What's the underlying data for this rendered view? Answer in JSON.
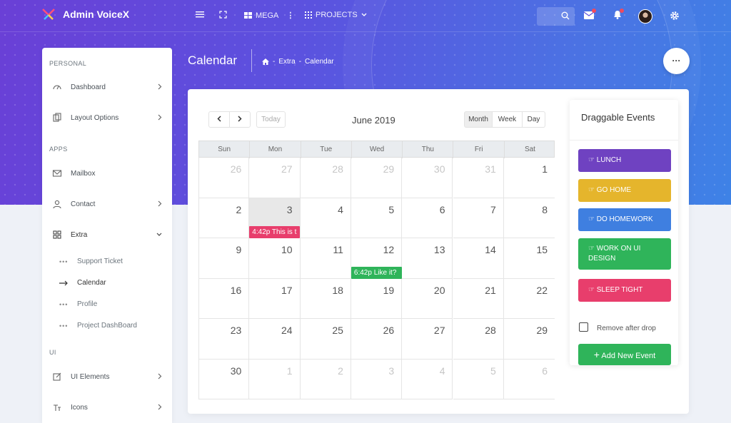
{
  "app": {
    "title": "Admin VoiceX"
  },
  "topbar": {
    "mega_label": "MEGA",
    "projects_label": "PROJECTS"
  },
  "sidebar": {
    "section_personal": "PERSONAL",
    "section_apps": "APPS",
    "section_ui": "UI",
    "items": [
      {
        "label": "Dashboard"
      },
      {
        "label": "Layout Options"
      },
      {
        "label": "Mailbox"
      },
      {
        "label": "Contact"
      },
      {
        "label": "Extra"
      },
      {
        "label": "UI Elements"
      },
      {
        "label": "Icons"
      }
    ],
    "extra_sub": [
      {
        "label": "Support Ticket"
      },
      {
        "label": "Calendar"
      },
      {
        "label": "Profile"
      },
      {
        "label": "Project DashBoard"
      }
    ]
  },
  "page": {
    "title": "Calendar",
    "breadcrumb": [
      "Extra",
      "Calendar"
    ],
    "more_label": "···"
  },
  "calendar": {
    "month_title": "June 2019",
    "today_label": "Today",
    "views": [
      "Month",
      "Week",
      "Day"
    ],
    "weekdays": [
      "Sun",
      "Mon",
      "Tue",
      "Wed",
      "Thu",
      "Fri",
      "Sat"
    ],
    "weeks": [
      [
        "26",
        "27",
        "28",
        "29",
        "30",
        "31",
        "1"
      ],
      [
        "2",
        "3",
        "4",
        "5",
        "6",
        "7",
        "8"
      ],
      [
        "9",
        "10",
        "11",
        "12",
        "13",
        "14",
        "15"
      ],
      [
        "16",
        "17",
        "18",
        "19",
        "20",
        "21",
        "22"
      ],
      [
        "23",
        "24",
        "25",
        "26",
        "27",
        "28",
        "29"
      ],
      [
        "30",
        "1",
        "2",
        "3",
        "4",
        "5",
        "6"
      ]
    ],
    "events": [
      {
        "text": "4:42p This is t",
        "color": "#e83e6c"
      },
      {
        "text": "6:42p Like it?",
        "color": "#2fb45a"
      }
    ]
  },
  "draggable": {
    "title": "Draggable Events",
    "events": [
      {
        "label": "LUNCH",
        "color": "#6f42c1"
      },
      {
        "label": "GO HOME",
        "color": "#e5b52c"
      },
      {
        "label": "DO HOMEWORK",
        "color": "#3f7fe0"
      },
      {
        "label": "WORK ON UI DESIGN",
        "color": "#2fb45a"
      },
      {
        "label": "SLEEP TIGHT",
        "color": "#e83e6c"
      }
    ],
    "remove_label": "Remove after drop",
    "add_label": "Add New Event"
  }
}
